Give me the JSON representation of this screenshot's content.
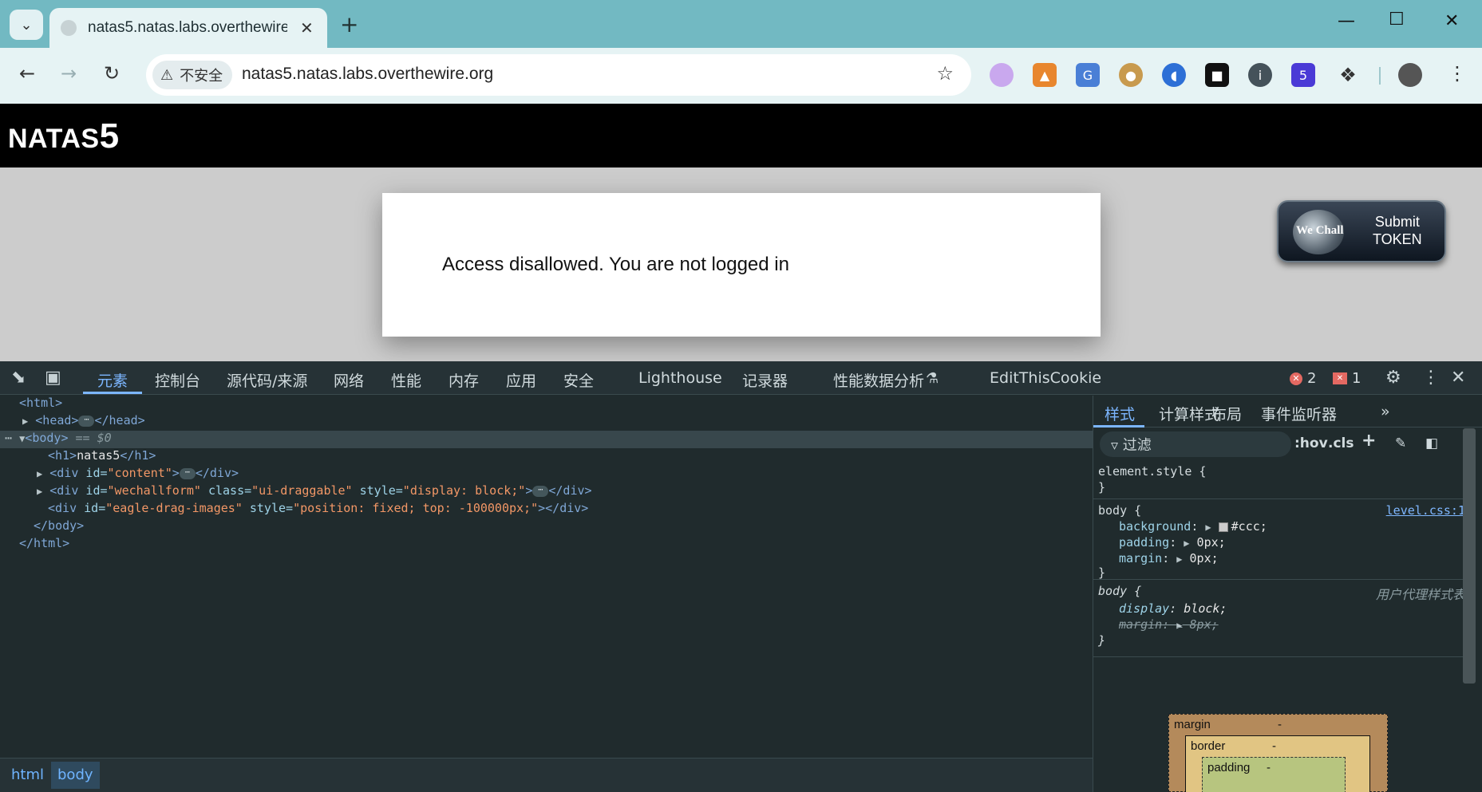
{
  "browser": {
    "tab_title": "natas5.natas.labs.overthewire",
    "insecure_label": "不安全",
    "url": "natas5.natas.labs.overthewire.org",
    "extension_badge": "5"
  },
  "page": {
    "header_prefix": "NATAS",
    "header_number": "5",
    "message": "Access disallowed. You are not logged in",
    "wechall_label": "We Chall",
    "submit_line1": "Submit",
    "submit_line2": "TOKEN"
  },
  "devtools": {
    "tabs": [
      "元素",
      "控制台",
      "源代码/来源",
      "网络",
      "性能",
      "内存",
      "应用",
      "安全",
      "Lighthouse",
      "记录器",
      "性能数据分析",
      "EditThisCookie"
    ],
    "error_count": "2",
    "issue_count": "1",
    "elements": {
      "html_open": "<html>",
      "head_open": "<head>",
      "head_close": "</head>",
      "body_open": "<body>",
      "body_marker": "== $0",
      "h1_open": "<h1>",
      "h1_text": "natas5",
      "h1_close": "</h1>",
      "div_tag": "<div",
      "div_close": "</div>",
      "close_bracket": ">",
      "content_attr": "id=",
      "content_val": "\"content\"",
      "wechall_attr1": "id=",
      "wechall_val1": "\"wechallform\"",
      "wechall_attr2": "class=",
      "wechall_val2": "\"ui-draggable\"",
      "wechall_attr3": "style=",
      "wechall_val3": "\"display: block;\"",
      "eagle_attr1": "id=",
      "eagle_val1": "\"eagle-drag-images\"",
      "eagle_attr2": "style=",
      "eagle_val2": "\"position: fixed; top: -100000px;\"",
      "body_close": "</body>",
      "html_close": "</html>"
    },
    "breadcrumbs": [
      "html",
      "body"
    ],
    "styles_tabs": [
      "样式",
      "计算样式",
      "布局",
      "事件监听器"
    ],
    "filter_placeholder": "过滤",
    "hov_label": ":hov",
    "cls_label": ".cls",
    "rules": {
      "element_style": "element.style {",
      "close_brace": "}",
      "body_selector": "body {",
      "source": "level.css:1",
      "background_prop": "background",
      "background_val": "#ccc;",
      "padding_prop": "padding",
      "padding_val": "0px;",
      "margin_prop": "margin",
      "margin_val": "0px;",
      "ua_selector": "body {",
      "ua_label": "用户代理样式表",
      "display_prop": "display",
      "display_val": "block;",
      "ua_margin_prop": "margin",
      "ua_margin_val": "8px;"
    },
    "box_model": {
      "margin_label": "margin",
      "border_label": "border",
      "padding_label": "padding",
      "dash": "-"
    }
  }
}
